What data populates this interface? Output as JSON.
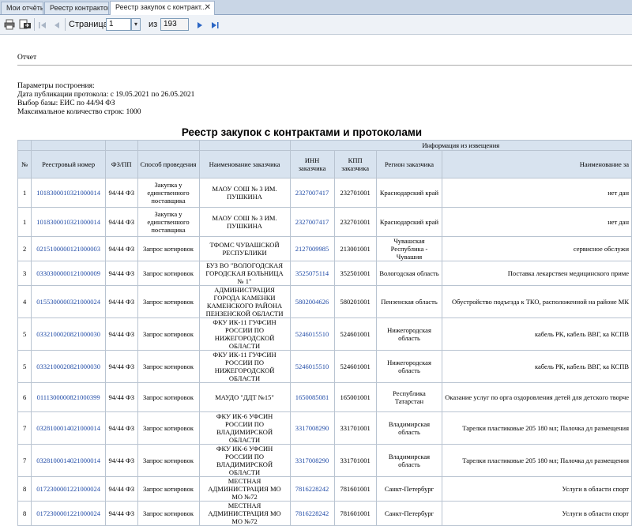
{
  "tabs": [
    {
      "label": "Мои отчёты"
    },
    {
      "label": "Реестр контрактов"
    },
    {
      "label": "Реестр закупок с контракт..."
    }
  ],
  "toolbar": {
    "page_label": "Страница",
    "page_value": "1",
    "of_label": "из",
    "total_pages": "193"
  },
  "report": {
    "heading": "Отчет",
    "params_title": "Параметры построения:",
    "params": [
      "Дата публикации протокола: с 19.05.2021 по 26.05.2021",
      "Выбор базы: ЕИС по 44/94 ФЗ",
      "Максимальное количество строк: 1000"
    ],
    "title": "Реестр закупок с контрактами и протоколами"
  },
  "table": {
    "group_header": "Информация из извещения",
    "columns": [
      "№",
      "Реестровый номер",
      "ФЗ/ПП",
      "Способ проведения",
      "Наименование заказчика",
      "ИНН заказчика",
      "КПП заказчика",
      "Регион заказчика",
      "Наименование за"
    ],
    "rows": [
      {
        "n": "1",
        "reg": "1018300010321000014",
        "fz": "94/44 ФЗ",
        "method": "Закупка у единственного поставщика",
        "customer": "МАОУ СОШ № 3 ИМ. ПУШКИНА",
        "inn": "2327007417",
        "kpp": "232701001",
        "region": "Краснодарский край",
        "subject": "нет дан"
      },
      {
        "n": "1",
        "reg": "1018300010321000014",
        "fz": "94/44 ФЗ",
        "method": "Закупка у единственного поставщика",
        "customer": "МАОУ СОШ № 3 ИМ. ПУШКИНА",
        "inn": "2327007417",
        "kpp": "232701001",
        "region": "Краснодарский край",
        "subject": "нет дан"
      },
      {
        "n": "2",
        "reg": "0215100000121000003",
        "fz": "94/44 ФЗ",
        "method": "Запрос котировок",
        "customer": "ТФОМС ЧУВАШСКОЙ РЕСПУБЛИКИ",
        "inn": "2127009985",
        "kpp": "213001001",
        "region": "Чувашская Республика - Чувашия",
        "subject": "сервисное обслужи"
      },
      {
        "n": "3",
        "reg": "0330300000121000009",
        "fz": "94/44 ФЗ",
        "method": "Запрос котировок",
        "customer": "БУЗ ВО \"ВОЛОГОДСКАЯ ГОРОДСКАЯ БОЛЬНИЦА № 1\"",
        "inn": "3525075114",
        "kpp": "352501001",
        "region": "Вологодская область",
        "subject": "Поставка лекарствен медицинского приме"
      },
      {
        "n": "4",
        "reg": "0155300000321000024",
        "fz": "94/44 ФЗ",
        "method": "Запрос котировок",
        "customer": "АДМИНИСТРАЦИЯ ГОРОДА КАМЕНКИ КАМЕНСКОГО РАЙОНА ПЕНЗЕНСКОЙ ОБЛАСТИ",
        "inn": "5802004626",
        "kpp": "580201001",
        "region": "Пензенская область",
        "subject": "Обустройство подъезда к ТКО, расположенной на районе МК"
      },
      {
        "n": "5",
        "reg": "0332100020821000030",
        "fz": "94/44 ФЗ",
        "method": "Запрос котировок",
        "customer": "ФКУ ИК-11 ГУФСИН РОССИИ ПО НИЖЕГОРОДСКОЙ ОБЛАСТИ",
        "inn": "5246015510",
        "kpp": "524601001",
        "region": "Нижегородская область",
        "subject": "кабель РК, кабель ВВГ, ка КСПВ"
      },
      {
        "n": "5",
        "reg": "0332100020821000030",
        "fz": "94/44 ФЗ",
        "method": "Запрос котировок",
        "customer": "ФКУ ИК-11 ГУФСИН РОССИИ ПО НИЖЕГОРОДСКОЙ ОБЛАСТИ",
        "inn": "5246015510",
        "kpp": "524601001",
        "region": "Нижегородская область",
        "subject": "кабель РК, кабель ВВГ, ка КСПВ"
      },
      {
        "n": "6",
        "reg": "0111300000821000399",
        "fz": "94/44 ФЗ",
        "method": "Запрос котировок",
        "customer": "МАУДО \"ДДТ №15\"",
        "inn": "1650085081",
        "kpp": "165001001",
        "region": "Республика Татарстан",
        "subject": "Оказание услуг по орга оздоровления детей для детского творче"
      },
      {
        "n": "7",
        "reg": "0328100014021000014",
        "fz": "94/44 ФЗ",
        "method": "Запрос котировок",
        "customer": "ФКУ ИК-6 УФСИН РОССИИ ПО ВЛАДИМИРСКОЙ ОБЛАСТИ",
        "inn": "3317008290",
        "kpp": "331701001",
        "region": "Владимирская область",
        "subject": "Тарелки пластиковые 205 180 мл; Палочка дл размещения"
      },
      {
        "n": "7",
        "reg": "0328100014021000014",
        "fz": "94/44 ФЗ",
        "method": "Запрос котировок",
        "customer": "ФКУ ИК-6 УФСИН РОССИИ ПО ВЛАДИМИРСКОЙ ОБЛАСТИ",
        "inn": "3317008290",
        "kpp": "331701001",
        "region": "Владимирская область",
        "subject": "Тарелки пластиковые 205 180 мл; Палочка дл размещения"
      },
      {
        "n": "8",
        "reg": "0172300001221000024",
        "fz": "94/44 ФЗ",
        "method": "Запрос котировок",
        "customer": "МЕСТНАЯ АДМИНИСТРАЦИЯ МО МО №72",
        "inn": "7816228242",
        "kpp": "781601001",
        "region": "Санкт-Петербург",
        "subject": "Услуги в области спорт"
      },
      {
        "n": "8",
        "reg": "0172300001221000024",
        "fz": "94/44 ФЗ",
        "method": "Запрос котировок",
        "customer": "МЕСТНАЯ АДМИНИСТРАЦИЯ МО МО №72",
        "inn": "7816228242",
        "kpp": "781601001",
        "region": "Санкт-Петербург",
        "subject": "Услуги в области спорт"
      }
    ]
  }
}
